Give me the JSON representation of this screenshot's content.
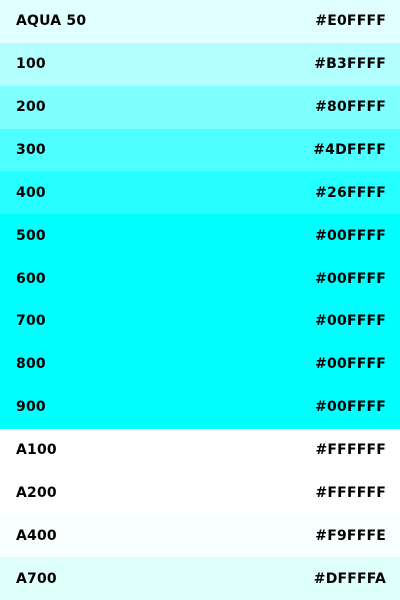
{
  "swatches": [
    {
      "label": "AQUA 50",
      "hex": "#E0FFFF",
      "color": "#E0FFFF"
    },
    {
      "label": "100",
      "hex": "#B3FFFF",
      "color": "#B3FFFF"
    },
    {
      "label": "200",
      "hex": "#80FFFF",
      "color": "#80FFFF"
    },
    {
      "label": "300",
      "hex": "#4DFFFF",
      "color": "#4DFFFF"
    },
    {
      "label": "400",
      "hex": "#26FFFF",
      "color": "#26FFFF"
    },
    {
      "label": "500",
      "hex": "#00FFFF",
      "color": "#00FFFF"
    },
    {
      "label": "600",
      "hex": "#00FFFF",
      "color": "#00FFFF"
    },
    {
      "label": "700",
      "hex": "#00FFFF",
      "color": "#00FFFF"
    },
    {
      "label": "800",
      "hex": "#00FFFF",
      "color": "#00FFFF"
    },
    {
      "label": "900",
      "hex": "#00FFFF",
      "color": "#00FFFF"
    },
    {
      "label": "A100",
      "hex": "#FFFFFF",
      "color": "#FFFFFF"
    },
    {
      "label": "A200",
      "hex": "#FFFFFF",
      "color": "#FFFFFF"
    },
    {
      "label": "A400",
      "hex": "#F9FFFE",
      "color": "#F9FFFE"
    },
    {
      "label": "A700",
      "hex": "#DFFFFA",
      "color": "#DFFFFA"
    }
  ]
}
